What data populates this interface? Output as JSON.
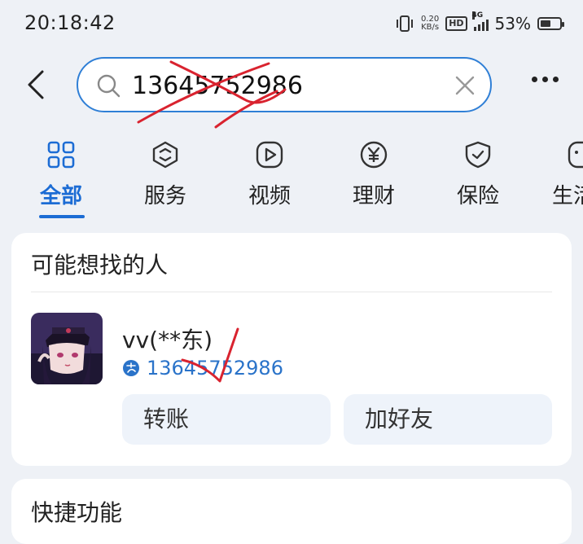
{
  "status_bar": {
    "time": "20:18:42",
    "net_speed_value": "0.20",
    "net_speed_unit": "KB/s",
    "hd": "HD",
    "network": "4G",
    "battery_percent": "53%",
    "battery_level": 0.53
  },
  "search": {
    "query": "13645752986",
    "back_icon": "chevron-left-icon",
    "search_icon": "search-icon",
    "clear_icon": "close-icon",
    "more_icon": "more-dots-icon"
  },
  "tabs": [
    {
      "label": "全部",
      "icon": "grid-icon",
      "active": true
    },
    {
      "label": "服务",
      "icon": "service-cube-icon"
    },
    {
      "label": "视频",
      "icon": "play-icon"
    },
    {
      "label": "理财",
      "icon": "yuan-icon"
    },
    {
      "label": "保险",
      "icon": "shield-check-icon"
    },
    {
      "label": "生活",
      "icon": "life-icon"
    }
  ],
  "people_card": {
    "title": "可能想找的人",
    "person": {
      "name": "vv(**东)",
      "account": "13645752986",
      "account_icon": "alipay-icon"
    },
    "buttons": {
      "transfer": "转账",
      "add_friend": "加好友"
    }
  },
  "shortcut_card": {
    "title": "快捷功能"
  },
  "colors": {
    "accent": "#1c6cd4",
    "scribble": "#d9232f",
    "background": "#eef1f6"
  }
}
